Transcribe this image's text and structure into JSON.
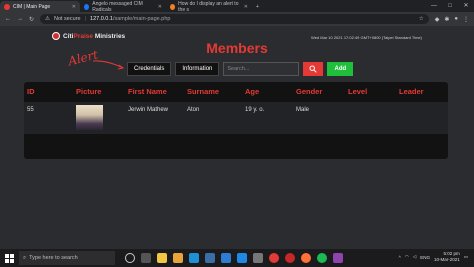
{
  "browser": {
    "tabs": [
      {
        "label": "CIM | Main Page",
        "color": "#e53935"
      },
      {
        "label": "Angelo messaged CIM Radicals",
        "color": "#1877f2"
      },
      {
        "label": "How do I display an alert to the s",
        "color": "#f48024"
      }
    ],
    "not_secure": "Not secure",
    "url_host": "127.0.0.1",
    "url_path": "/sample/main-page.php",
    "new_tab": "+",
    "window_controls": [
      "—",
      "□",
      "✕"
    ]
  },
  "page": {
    "brand_prefix": "Citi",
    "brand_mid": "Praise",
    "brand_suffix": "Ministries",
    "datetime": "Wed Mar 10 2021 17:02:49 GMT+0800 (Taipei Standard Time)",
    "title": "Members",
    "annotation": "Alert",
    "toolbar": {
      "credentials": "Credentials",
      "information": "Information",
      "search_placeholder": "Search...",
      "add": "Add"
    },
    "table": {
      "headers": [
        "ID",
        "Picture",
        "First Name",
        "Surname",
        "Age",
        "Gender",
        "Level",
        "Leader"
      ],
      "rows": [
        {
          "id": "55",
          "first_name": "Jerwin Mathew",
          "surname": "Aton",
          "age": "19 y. o.",
          "gender": "Male",
          "level": "",
          "leader": ""
        }
      ]
    }
  },
  "taskbar": {
    "search": "Type here to search",
    "lang": "ENG",
    "time": "5:02 pm",
    "date": "10-Mar-2021"
  },
  "colors": {
    "accent": "#e53935",
    "add": "#1fbf3b"
  }
}
